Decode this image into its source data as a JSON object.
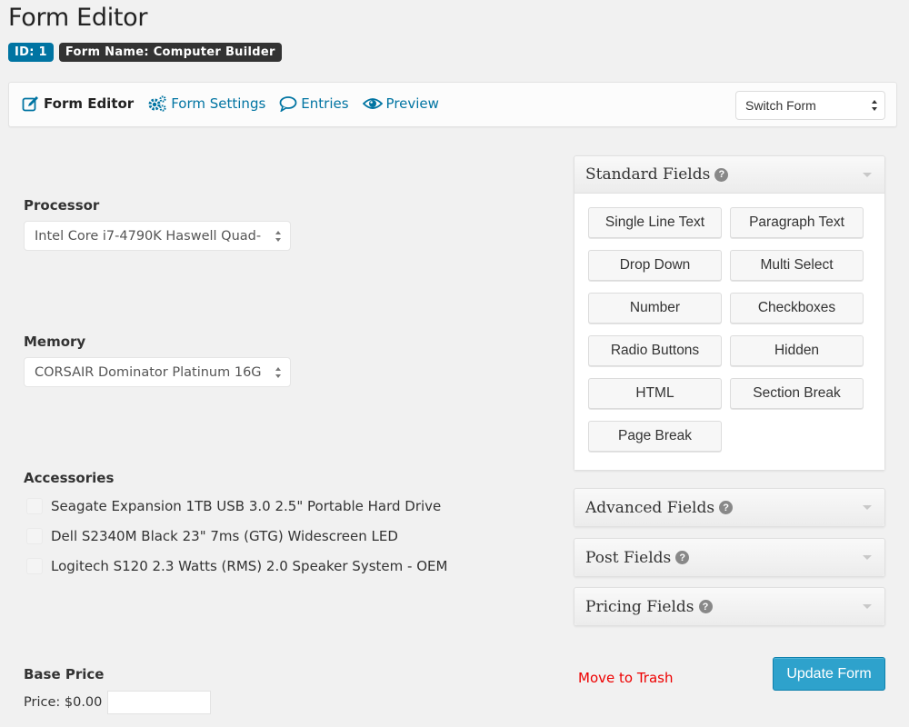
{
  "page": {
    "title": "Form Editor",
    "id_badge": "ID: 1",
    "name_badge": "Form Name: Computer Builder"
  },
  "toolbar": {
    "nav": [
      {
        "label": "Form Editor",
        "icon": "edit-icon",
        "active": true
      },
      {
        "label": "Form Settings",
        "icon": "gears-icon",
        "active": false
      },
      {
        "label": "Entries",
        "icon": "comment-icon",
        "active": false
      },
      {
        "label": "Preview",
        "icon": "eye-icon",
        "active": false
      }
    ],
    "switch_form": "Switch Form"
  },
  "form": {
    "processor": {
      "label": "Processor",
      "value": "Intel Core i7-4790K Haswell Quad-"
    },
    "memory": {
      "label": "Memory",
      "value": "CORSAIR Dominator Platinum 16G"
    },
    "accessories": {
      "label": "Accessories",
      "options": [
        {
          "label": "Seagate Expansion 1TB USB 3.0 2.5\" Portable Hard Drive",
          "checked": false
        },
        {
          "label": "Dell S2340M Black 23\" 7ms (GTG) Widescreen LED",
          "checked": false
        },
        {
          "label": "Logitech S120 2.3 Watts (RMS) 2.0 Speaker System - OEM",
          "checked": false
        }
      ]
    },
    "base_price": {
      "label": "Base Price",
      "price_text": "Price: $0.00",
      "input_value": ""
    }
  },
  "sidebar": {
    "standard": {
      "title": "Standard Fields",
      "buttons": [
        "Single Line Text",
        "Paragraph Text",
        "Drop Down",
        "Multi Select",
        "Number",
        "Checkboxes",
        "Radio Buttons",
        "Hidden",
        "HTML",
        "Section Break",
        "Page Break"
      ]
    },
    "advanced": {
      "title": "Advanced Fields"
    },
    "post": {
      "title": "Post Fields"
    },
    "pricing": {
      "title": "Pricing Fields"
    }
  },
  "actions": {
    "trash": "Move to Trash",
    "update": "Update Form"
  },
  "colors": {
    "link": "#0074a2",
    "primary_button": "#2ea2cc",
    "trash": "#ee0000",
    "badge_id": "#0074a2",
    "badge_name": "#333333"
  }
}
